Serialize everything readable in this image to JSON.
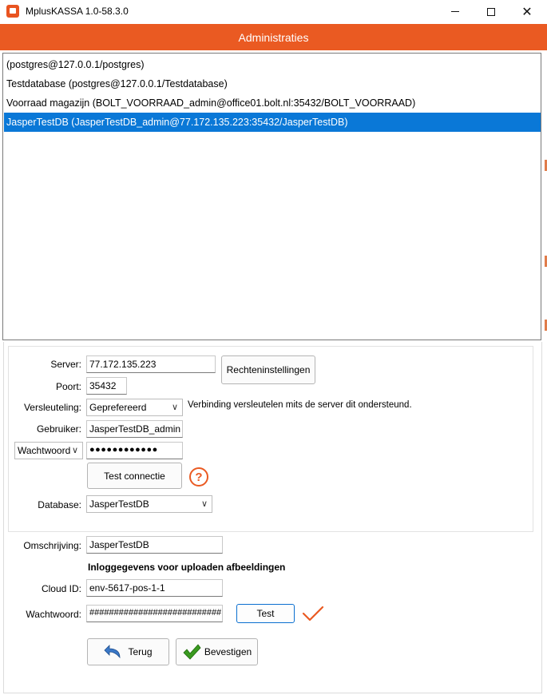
{
  "window": {
    "title": "MplusKASSA 1.0-58.3.0"
  },
  "header": {
    "title": "Administraties"
  },
  "databases": [
    {
      "label": "(postgres@127.0.0.1/postgres)",
      "selected": false
    },
    {
      "label": "Testdatabase (postgres@127.0.0.1/Testdatabase)",
      "selected": false
    },
    {
      "label": "Voorraad magazijn (BOLT_VOORRAAD_admin@office01.bolt.nl:35432/BOLT_VOORRAAD)",
      "selected": false
    },
    {
      "label": "JasperTestDB (JasperTestDB_admin@77.172.135.223:35432/JasperTestDB)",
      "selected": true
    }
  ],
  "connection": {
    "server_label": "Server:",
    "server_value": "77.172.135.223",
    "rights_button": "Rechteninstellingen",
    "port_label": "Poort:",
    "port_value": "35432",
    "encryption_label": "Versleuteling:",
    "encryption_value": "Geprefereerd",
    "encryption_note": "Verbinding versleutelen mits de server dit ondersteund.",
    "user_label": "Gebruiker:",
    "user_value": "JasperTestDB_admin",
    "auth_type_value": "Wachtwoord",
    "password_value": "●●●●●●●●●●●●",
    "test_button": "Test connectie",
    "help_symbol": "?",
    "database_label": "Database:",
    "database_value": "JasperTestDB"
  },
  "description": {
    "label": "Omschrijving:",
    "value": "JasperTestDB"
  },
  "upload": {
    "heading": "Inloggegevens voor uploaden afbeeldingen",
    "cloud_label": "Cloud ID:",
    "cloud_value": "env-5617-pos-1-1",
    "password_label": "Wachtwoord:",
    "password_value": "###########################",
    "test_button": "Test",
    "status_icon": "checkmark-icon"
  },
  "footer": {
    "back_button": "Terug",
    "confirm_button": "Bevestigen"
  },
  "colors": {
    "accent": "#ea5a22",
    "selection": "#0a78d7",
    "check_green": "#3a9a1f"
  }
}
